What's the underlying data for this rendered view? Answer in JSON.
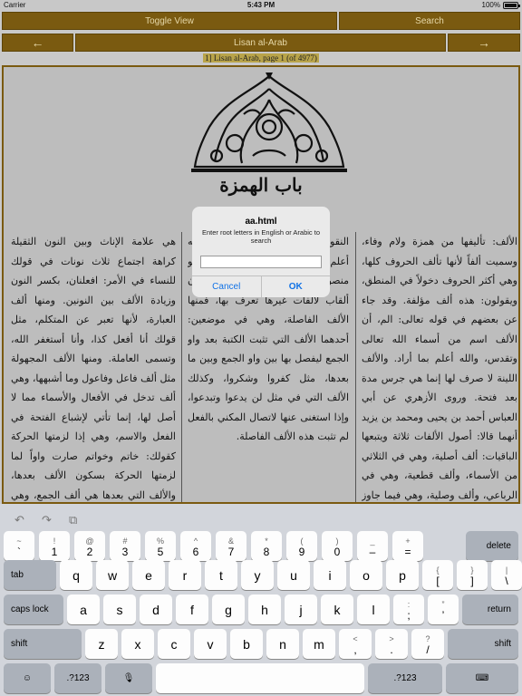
{
  "status": {
    "carrier": "Carrier",
    "time": "5:43 PM",
    "battery": "100%"
  },
  "toolbar": {
    "toggle_label": "Toggle View",
    "search_label": "Search",
    "prev_label": "←",
    "next_label": "→",
    "book_title": "Lisan al-Arab"
  },
  "page_info": "1] Lisan al-Arab, page 1 (of 4977)",
  "page": {
    "heading": "باب الهمزة",
    "col_right": "الألف: تأليفها من همزة ولام وفاء، وسميت ألفاً لأنها تألف الحروف كلها، وهي أكثر الحروف دخولاً في المنطق، ويقولون: هذه ألف مؤلفة. وقد جاء عن بعضهم في قوله تعالى: الم، أن الألف اسم من أسماء الله تعالى وتقدس، والله أعلم بما أراد. والألف اللينة لا صرف لها إنما هي جرس مدة بعد فتحة. وروى الأزهري عن أبي العباس أحمد بن يحيى ومحمد بن يزيد أنهما قالا: أصول الألفات ثلاثة ويتبعها الباقيات: ألف أصلية، وهي في الثلاثي من الأسماء، وألف قطعية، وهي في الرباعي، وألف وصلية، وهي فيما جاوز الرباعي. قال: فالأصلية مثل ألف ألف وألف وأخذ وأكل وأمر وأشبهه.",
    "col_mid": "النقو والقطعية ... كما فكفو وقوله: الله أعلم أم الله. ألا الأنشأ شجرتها. قال أبو منصور: فهذه الألف الألفات. والنحويون ألقاب لألفات غيرها تعرف بها، فمنها الألف الفاصلة، وهي في موضعين: أحدهما الألف التي تثبت الكتبة بعد واو الجمع ليفصل بها بين واو الجمع وبين ما بعدها، مثل كفروا وشكروا، وكذلك الألف التي في مثل لن يدعوا وتبدعوا، وإذا استغنى عنها لاتصال المكني بالفعل لم تثبت هذه الألف الفاصلة.",
    "col_left": "هي علامة الإناث وبين النون الثقيلة كراهة اجتماع ثلاث نونات في قولك للنساء في الأمر: افعلنان، بكسر النون وزيادة الألف بين النونين. ومنها ألف العبارة، لأنها تعبر عن المتكلم، مثل قولك أنا أفعل كذا، وأنا أستغفر الله، وتسمى العاملة. ومنها الألف المجهولة مثل ألف فاعل وفاعول وما أشبهها، وهي ألف تدخل في الأفعال والأسماء مما لا أصل لها، إنما تأتي لإشباع الفتحة في الفعل والاسم، وهي إذا لزمتها الحركة كقولك: خاتم وخواتم صارت واواً لما لزمتها الحركة بسكون الألف بعدها، والألف التي بعدها هي ألف الجمع، وهي مجهولة أيضاً."
  },
  "alert": {
    "title": "aa.html",
    "message": "Enter root letters in English or Arabic to search",
    "input_value": "",
    "cancel_label": "Cancel",
    "ok_label": "OK"
  },
  "keyboard": {
    "shortcuts": [
      "↶",
      "↷",
      "⧉"
    ],
    "row1": [
      {
        "top": "~",
        "bot": "`"
      },
      {
        "top": "!",
        "bot": "1"
      },
      {
        "top": "@",
        "bot": "2"
      },
      {
        "top": "#",
        "bot": "3"
      },
      {
        "top": "%",
        "bot": "5"
      },
      {
        "top": "^",
        "bot": "6"
      },
      {
        "top": "&",
        "bot": "7"
      },
      {
        "top": "*",
        "bot": "8"
      },
      {
        "top": "(",
        "bot": "9"
      },
      {
        "top": ")",
        "bot": "0"
      },
      {
        "top": "_",
        "bot": "–"
      },
      {
        "top": "+",
        "bot": "="
      }
    ],
    "delete_label": "delete",
    "tab_label": "tab",
    "row2": [
      "q",
      "w",
      "e",
      "r",
      "t",
      "y",
      "u",
      "i",
      "o",
      "p"
    ],
    "row2_extra": [
      {
        "top": "{",
        "bot": "["
      },
      {
        "top": "}",
        "bot": "]"
      },
      {
        "top": "|",
        "bot": "\\"
      }
    ],
    "caps_label": "caps lock",
    "row3": [
      "a",
      "s",
      "d",
      "f",
      "g",
      "h",
      "j",
      "k",
      "l"
    ],
    "row3_extra": [
      {
        "top": ":",
        "bot": ";"
      },
      {
        "top": "”",
        "bot": "’"
      }
    ],
    "return_label": "return",
    "shift_label": "shift",
    "row4": [
      "z",
      "x",
      "c",
      "v",
      "b",
      "n",
      "m"
    ],
    "row4_extra": [
      {
        "top": "<",
        "bot": ","
      },
      {
        "top": ">",
        "bot": "."
      },
      {
        "top": "?",
        "bot": "/"
      }
    ],
    "emoji_label": "☺",
    "numbers_label": ".?123",
    "mic_label": "🎙",
    "dismiss_label": "⌨"
  }
}
